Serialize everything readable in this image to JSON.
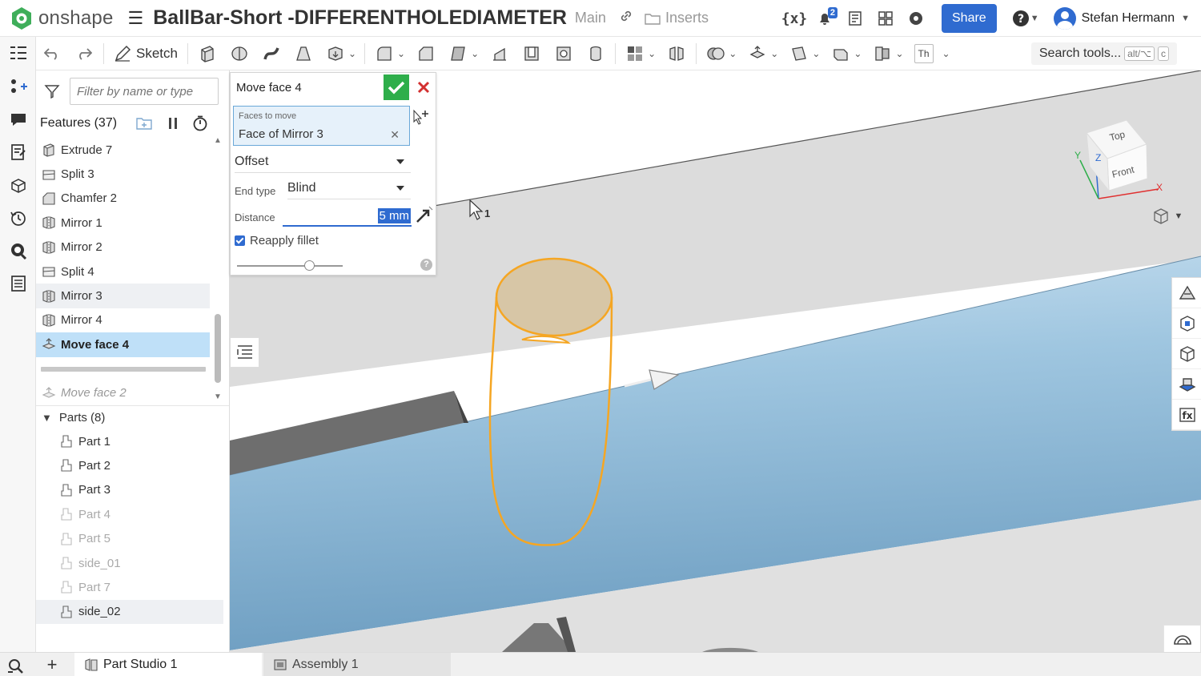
{
  "app": {
    "logo_text": "onshape",
    "document_title": "BallBar-Short -DIFFERENTHOLEDIAMETER",
    "branch": "Main",
    "inserts_label": "Inserts",
    "notification_count": "2",
    "share_label": "Share",
    "user_name": "Stefan Hermann"
  },
  "toolbar": {
    "sketch_label": "Sketch",
    "search_placeholder": "Search tools...",
    "search_shortcut": "alt/⌥",
    "search_shortcut_key": "c",
    "text_tool": "Th"
  },
  "feature_panel": {
    "filter_placeholder": "Filter by name or type",
    "features_title": "Features (37)",
    "features": [
      {
        "label": "Extrude 7",
        "icon": "extrude-icon"
      },
      {
        "label": "Split 3",
        "icon": "split-icon"
      },
      {
        "label": "Chamfer 2",
        "icon": "chamfer-icon"
      },
      {
        "label": "Mirror 1",
        "icon": "mirror-icon"
      },
      {
        "label": "Mirror 2",
        "icon": "mirror-icon"
      },
      {
        "label": "Split 4",
        "icon": "split-icon"
      },
      {
        "label": "Mirror 3",
        "icon": "mirror-icon"
      },
      {
        "label": "Mirror 4",
        "icon": "mirror-icon"
      },
      {
        "label": "Move face 4",
        "icon": "move-face-icon"
      }
    ],
    "suppressed_feature": "Move face 2",
    "parts_title": "Parts (8)",
    "parts": [
      {
        "label": "Part 1",
        "visible": true
      },
      {
        "label": "Part 2",
        "visible": true
      },
      {
        "label": "Part 3",
        "visible": true
      },
      {
        "label": "Part 4",
        "visible": false
      },
      {
        "label": "Part 5",
        "visible": false
      },
      {
        "label": "side_01",
        "visible": false
      },
      {
        "label": "Part 7",
        "visible": false
      },
      {
        "label": "side_02",
        "visible": true
      }
    ]
  },
  "dialog": {
    "title": "Move face 4",
    "faces_label": "Faces to move",
    "faces_value": "Face of Mirror 3",
    "move_type": "Offset",
    "end_type_label": "End type",
    "end_type_value": "Blind",
    "distance_label": "Distance",
    "distance_value": "5 mm",
    "reapply_fillet_label": "Reapply fillet",
    "reapply_fillet_checked": true,
    "help_glyph": "?"
  },
  "viewport": {
    "cursor_label": "1",
    "view_cube": {
      "top": "Top",
      "front": "Front",
      "axis_x": "X",
      "axis_y": "Y",
      "axis_z": "Z"
    }
  },
  "tabs": [
    {
      "label": "Part Studio 1",
      "active": true
    },
    {
      "label": "Assembly 1",
      "active": false
    }
  ],
  "colors": {
    "accent": "#2f6bd0",
    "ok_green": "#2eae4a",
    "cancel_red": "#d33030",
    "active_feature_bg": "#bfe0f8",
    "selection_orange": "#f5a623",
    "cylinder_blue": "#9fc6e0"
  }
}
